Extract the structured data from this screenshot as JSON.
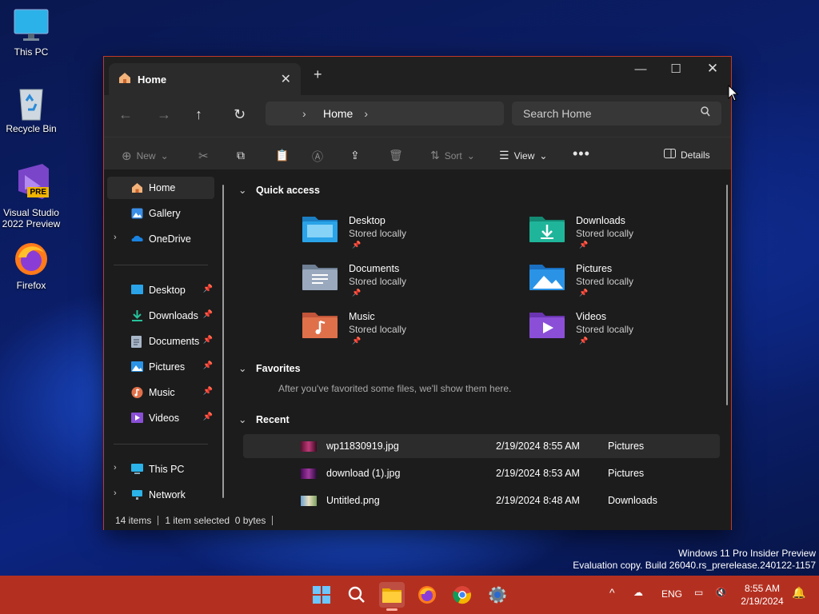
{
  "desktop": {
    "icons": [
      {
        "label": "This PC",
        "icon": "monitor-icon"
      },
      {
        "label": "Recycle Bin",
        "icon": "recycle-bin-icon"
      },
      {
        "label": "Visual Studio 2022 Preview",
        "icon": "visual-studio-icon",
        "badge": "PRE"
      },
      {
        "label": "Firefox",
        "icon": "firefox-icon"
      }
    ]
  },
  "explorer": {
    "tab_title": "Home",
    "address": {
      "crumb": "Home"
    },
    "search": {
      "placeholder": "Search Home"
    },
    "toolbar": {
      "new": "New",
      "sort": "Sort",
      "view": "View",
      "details": "Details"
    },
    "sidebar": {
      "top": [
        {
          "label": "Home",
          "icon": "home-icon",
          "selected": true
        },
        {
          "label": "Gallery",
          "icon": "gallery-icon"
        },
        {
          "label": "OneDrive",
          "icon": "onedrive-icon",
          "expandable": true
        }
      ],
      "pinned": [
        {
          "label": "Desktop",
          "icon": "desktop-folder-icon"
        },
        {
          "label": "Downloads",
          "icon": "downloads-folder-icon"
        },
        {
          "label": "Documents",
          "icon": "documents-folder-icon"
        },
        {
          "label": "Pictures",
          "icon": "pictures-folder-icon"
        },
        {
          "label": "Music",
          "icon": "music-folder-icon"
        },
        {
          "label": "Videos",
          "icon": "videos-folder-icon"
        }
      ],
      "bottom": [
        {
          "label": "This PC",
          "icon": "this-pc-icon"
        },
        {
          "label": "Network",
          "icon": "network-icon"
        }
      ]
    },
    "quick_access": {
      "heading": "Quick access",
      "items": [
        {
          "name": "Desktop",
          "sub": "Stored locally",
          "color": "#2aa3e8"
        },
        {
          "name": "Downloads",
          "sub": "Stored locally",
          "color": "#1fb59a"
        },
        {
          "name": "Documents",
          "sub": "Stored locally",
          "color": "#9aa9bd"
        },
        {
          "name": "Pictures",
          "sub": "Stored locally",
          "color": "#2a93e6"
        },
        {
          "name": "Music",
          "sub": "Stored locally",
          "color": "#e0704a"
        },
        {
          "name": "Videos",
          "sub": "Stored locally",
          "color": "#8a4fd6"
        }
      ]
    },
    "favorites": {
      "heading": "Favorites",
      "note": "After you've favorited some files, we'll show them here."
    },
    "recent": {
      "heading": "Recent",
      "files": [
        {
          "name": "wp11830919.jpg",
          "date": "2/19/2024 8:55 AM",
          "location": "Pictures"
        },
        {
          "name": "download (1).jpg",
          "date": "2/19/2024 8:53 AM",
          "location": "Pictures"
        },
        {
          "name": "Untitled.png",
          "date": "2/19/2024 8:48 AM",
          "location": "Downloads"
        }
      ]
    },
    "status": {
      "count": "14 items",
      "selection": "1 item selected  0 bytes"
    }
  },
  "watermark": {
    "line1": "Windows 11 Pro Insider Preview",
    "line2": "Evaluation copy. Build 26040.rs_prerelease.240122-1157"
  },
  "taskbar": {
    "lang": "ENG",
    "time": "8:55 AM",
    "date": "2/19/2024",
    "accent": "#b33021"
  }
}
